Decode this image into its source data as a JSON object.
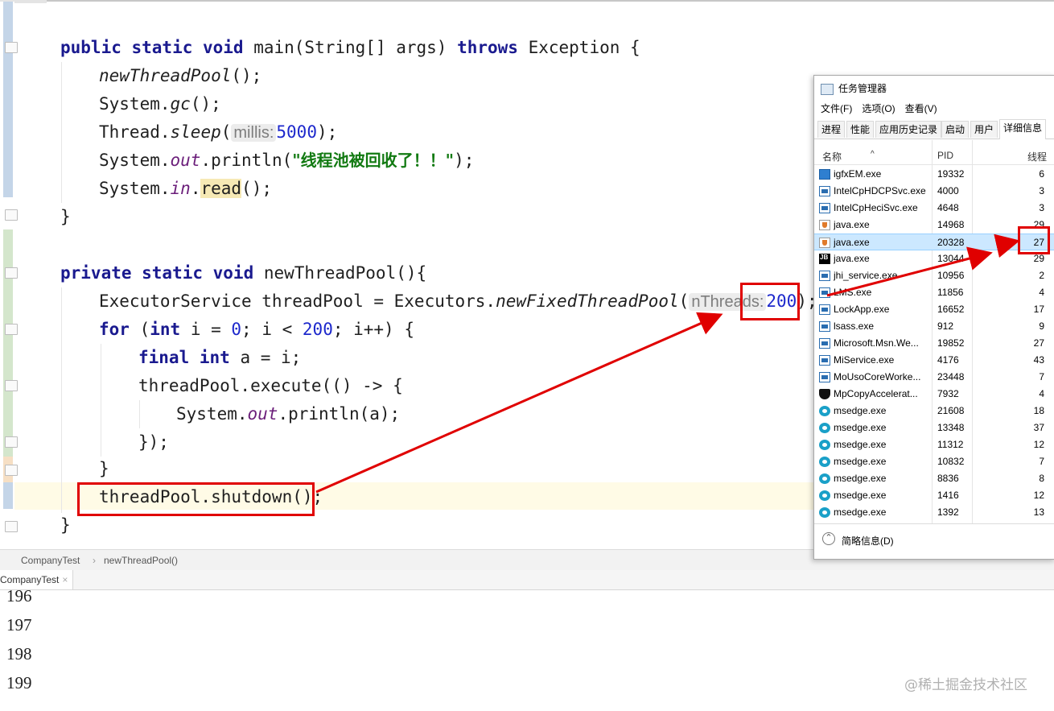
{
  "editor": {
    "lines": {
      "l1": {
        "kw1": "public static void",
        "rest": " main(String[] args) ",
        "kw2": "throws",
        "rest2": " Exception {"
      },
      "l2": {
        "call": "newThreadPool",
        "rest": "();"
      },
      "l3": {
        "pre": "System.",
        "m": "gc",
        "rest": "();"
      },
      "l4": {
        "pre": "Thread.",
        "m": "sleep",
        "open": "(",
        "hint": "millis:",
        "num": "5000",
        "rest": ");"
      },
      "l5": {
        "pre": "System.",
        "fld": "out",
        "mid": ".println(",
        "str": "\"线程池被回收了！！\"",
        "rest": ");"
      },
      "l6": {
        "pre": "System.",
        "fld": "in",
        "dot": ".",
        "hl": "read",
        "rest": "();"
      },
      "l7": "}",
      "l8": {
        "kw": "private static void",
        "rest": " newThreadPool(){"
      },
      "l9": {
        "pre": "ExecutorService threadPool = Executors.",
        "m": "newFixedThreadPool",
        "open": "(",
        "hint": "nThreads:",
        "num": "200",
        "rest": ");"
      },
      "l10": {
        "kw": "for",
        "a": " (",
        "kw2": "int",
        "b": " i = ",
        "n1": "0",
        "c": "; i < ",
        "n2": "200",
        "d": "; i++) {"
      },
      "l11": {
        "kw": "final int",
        "rest": " a = i;"
      },
      "l12": "threadPool.execute(() -> {",
      "l13": {
        "pre": "System.",
        "fld": "out",
        "rest": ".println(a);"
      },
      "l14": "});",
      "l15": "}",
      "l16": "threadPool.shutdown();",
      "l17": "}"
    }
  },
  "breadcrumb": {
    "file": "CompanyTest",
    "sep": "›",
    "method": "newThreadPool()"
  },
  "run_tab": {
    "label": "CompanyTest",
    "close": "×"
  },
  "output_lines": [
    "196",
    "197",
    "198",
    "199"
  ],
  "watermark": "@稀土掘金技术社区",
  "task_manager": {
    "title": "任务管理器",
    "menu": [
      "文件(F)",
      "选项(O)",
      "查看(V)"
    ],
    "tabs": [
      "进程",
      "性能",
      "应用历史记录",
      "启动",
      "用户",
      "详细信息"
    ],
    "active_tab": "详细信息",
    "columns": {
      "name": "名称",
      "pid": "PID",
      "threads": "线程"
    },
    "rows": [
      {
        "name": "igfxEM.exe",
        "pid": "19332",
        "threads": "6",
        "icon": "igfx-icon"
      },
      {
        "name": "IntelCpHDCPSvc.exe",
        "pid": "4000",
        "threads": "3",
        "icon": "service-icon"
      },
      {
        "name": "IntelCpHeciSvc.exe",
        "pid": "4648",
        "threads": "3",
        "icon": "service-icon"
      },
      {
        "name": "java.exe",
        "pid": "14968",
        "threads": "29",
        "icon": "java-icon"
      },
      {
        "name": "java.exe",
        "pid": "20328",
        "threads": "27",
        "icon": "java-icon",
        "selected": true
      },
      {
        "name": "java.exe",
        "pid": "13044",
        "threads": "29",
        "icon": "jetbrains-icon"
      },
      {
        "name": "jhi_service.exe",
        "pid": "10956",
        "threads": "2",
        "icon": "service-icon"
      },
      {
        "name": "LMS.exe",
        "pid": "11856",
        "threads": "4",
        "icon": "service-icon"
      },
      {
        "name": "LockApp.exe",
        "pid": "16652",
        "threads": "17",
        "icon": "service-icon"
      },
      {
        "name": "lsass.exe",
        "pid": "912",
        "threads": "9",
        "icon": "service-icon"
      },
      {
        "name": "Microsoft.Msn.We...",
        "pid": "19852",
        "threads": "27",
        "icon": "service-icon"
      },
      {
        "name": "MiService.exe",
        "pid": "4176",
        "threads": "43",
        "icon": "service-icon"
      },
      {
        "name": "MoUsoCoreWorke...",
        "pid": "23448",
        "threads": "7",
        "icon": "service-icon"
      },
      {
        "name": "MpCopyAccelerat...",
        "pid": "7932",
        "threads": "4",
        "icon": "shield-icon"
      },
      {
        "name": "msedge.exe",
        "pid": "21608",
        "threads": "18",
        "icon": "edge-icon"
      },
      {
        "name": "msedge.exe",
        "pid": "13348",
        "threads": "37",
        "icon": "edge-icon"
      },
      {
        "name": "msedge.exe",
        "pid": "11312",
        "threads": "12",
        "icon": "edge-icon"
      },
      {
        "name": "msedge.exe",
        "pid": "10832",
        "threads": "7",
        "icon": "edge-icon"
      },
      {
        "name": "msedge.exe",
        "pid": "8836",
        "threads": "8",
        "icon": "edge-icon"
      },
      {
        "name": "msedge.exe",
        "pid": "1416",
        "threads": "12",
        "icon": "edge-icon"
      },
      {
        "name": "msedge.exe",
        "pid": "1392",
        "threads": "13",
        "icon": "edge-icon"
      }
    ],
    "footer": "简略信息(D)"
  },
  "colors": {
    "annotation_red": "#e00000",
    "keyword": "#1a1a8f",
    "number": "#1d28cc",
    "string": "#127a12",
    "selection": "#cce8ff"
  }
}
